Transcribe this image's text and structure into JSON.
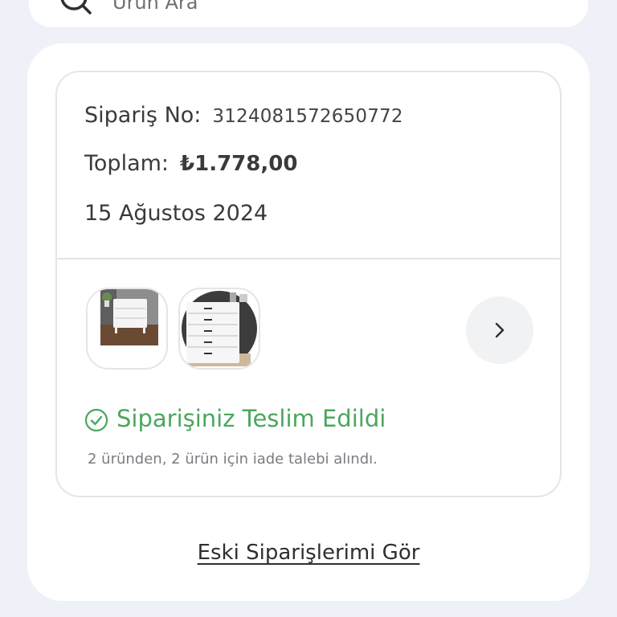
{
  "search": {
    "placeholder": "Ürün Ara",
    "icon": "search-icon"
  },
  "order": {
    "number_label": "Sipariş No:",
    "number_value": "3124081572650772",
    "total_label": "Toplam:",
    "total_value": "₺1.778,00",
    "date": "15 Ağustos 2024",
    "products": [
      {
        "name": "product-nightstand-thumbnail"
      },
      {
        "name": "product-dresser-thumbnail"
      }
    ],
    "next_icon": "chevron-right-icon",
    "status_icon": "check-circle-icon",
    "status": "Siparişiniz Teslim Edildi",
    "return_note": "2 üründen, 2 ürün için iade talebi alındı.",
    "colors": {
      "status_green": "#4aa75d",
      "card_border": "#e3e5ea",
      "page_background": "#eef1f7"
    }
  },
  "footer": {
    "old_orders_link": "Eski Siparişlerimi Gör"
  }
}
